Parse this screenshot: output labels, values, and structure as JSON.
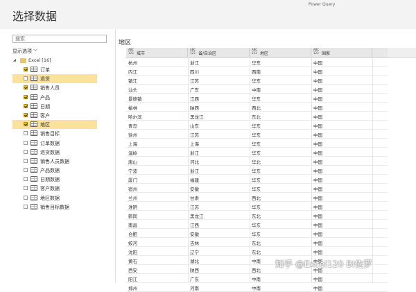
{
  "window": {
    "title": "选择数据",
    "app_name": "Power Query"
  },
  "navigator": {
    "search_placeholder": "搜索",
    "display_options": "显示选项",
    "root_label": "Excel [16]",
    "items": [
      {
        "label": "订单",
        "type": "table",
        "checked": true,
        "selected": false
      },
      {
        "label": "退货",
        "type": "table",
        "checked": false,
        "selected": true
      },
      {
        "label": "销售人员",
        "type": "table",
        "checked": true,
        "selected": false
      },
      {
        "label": "产品",
        "type": "table",
        "checked": true,
        "selected": false
      },
      {
        "label": "日期",
        "type": "table",
        "checked": true,
        "selected": false
      },
      {
        "label": "客户",
        "type": "table",
        "checked": true,
        "selected": false
      },
      {
        "label": "地区",
        "type": "table",
        "checked": true,
        "selected": true
      },
      {
        "label": "销售目标",
        "type": "table",
        "checked": false,
        "selected": false
      },
      {
        "label": "订单数据",
        "type": "sheet",
        "checked": false,
        "selected": false
      },
      {
        "label": "退货数据",
        "type": "sheet",
        "checked": false,
        "selected": false
      },
      {
        "label": "销售人员数据",
        "type": "sheet",
        "checked": false,
        "selected": false
      },
      {
        "label": "产品数据",
        "type": "sheet",
        "checked": false,
        "selected": false
      },
      {
        "label": "日期数据",
        "type": "sheet",
        "checked": false,
        "selected": false
      },
      {
        "label": "客户数据",
        "type": "sheet",
        "checked": false,
        "selected": false
      },
      {
        "label": "地区数据",
        "type": "sheet",
        "checked": false,
        "selected": false
      },
      {
        "label": "销售目标数据",
        "type": "sheet",
        "checked": false,
        "selected": false
      }
    ]
  },
  "preview": {
    "title": "地区",
    "type_icon": "ABC\n123",
    "columns": [
      "城市",
      "省/自治区",
      "地区",
      "国家"
    ],
    "rows": [
      [
        "杭州",
        "浙江",
        "华东",
        "中国"
      ],
      [
        "内江",
        "四川",
        "西南",
        "中国"
      ],
      [
        "镇江",
        "江苏",
        "华东",
        "中国"
      ],
      [
        "汕头",
        "广东",
        "中南",
        "中国"
      ],
      [
        "景德镇",
        "江西",
        "华东",
        "中国"
      ],
      [
        "榆林",
        "陕西",
        "西北",
        "中国"
      ],
      [
        "哈尔滨",
        "黑龙江",
        "东北",
        "中国"
      ],
      [
        "青岛",
        "山东",
        "华东",
        "中国"
      ],
      [
        "徐州",
        "江苏",
        "华东",
        "中国"
      ],
      [
        "上海",
        "上海",
        "华东",
        "中国"
      ],
      [
        "温岭",
        "浙江",
        "华东",
        "中国"
      ],
      [
        "唐山",
        "河北",
        "华北",
        "中国"
      ],
      [
        "宁波",
        "浙江",
        "华东",
        "中国"
      ],
      [
        "厦门",
        "福建",
        "华东",
        "中国"
      ],
      [
        "宿州",
        "安徽",
        "华东",
        "中国"
      ],
      [
        "兰州",
        "甘肃",
        "西北",
        "中国"
      ],
      [
        "淮阴",
        "江苏",
        "华东",
        "中国"
      ],
      [
        "鹤岗",
        "黑龙江",
        "东北",
        "中国"
      ],
      [
        "南昌",
        "江西",
        "华东",
        "中国"
      ],
      [
        "合肥",
        "安徽",
        "华东",
        "中国"
      ],
      [
        "蛟河",
        "吉林",
        "东北",
        "中国"
      ],
      [
        "沈阳",
        "辽宁",
        "东北",
        "中国"
      ],
      [
        "黄石",
        "湖北",
        "中南",
        "中国"
      ],
      [
        "西安",
        "陕西",
        "西北",
        "中国"
      ],
      [
        "阳江",
        "广东",
        "中南",
        "中国"
      ],
      [
        "郑州",
        "河南",
        "中南",
        "中国"
      ]
    ]
  },
  "watermark": "知乎 @Excel120 BI佐罗"
}
